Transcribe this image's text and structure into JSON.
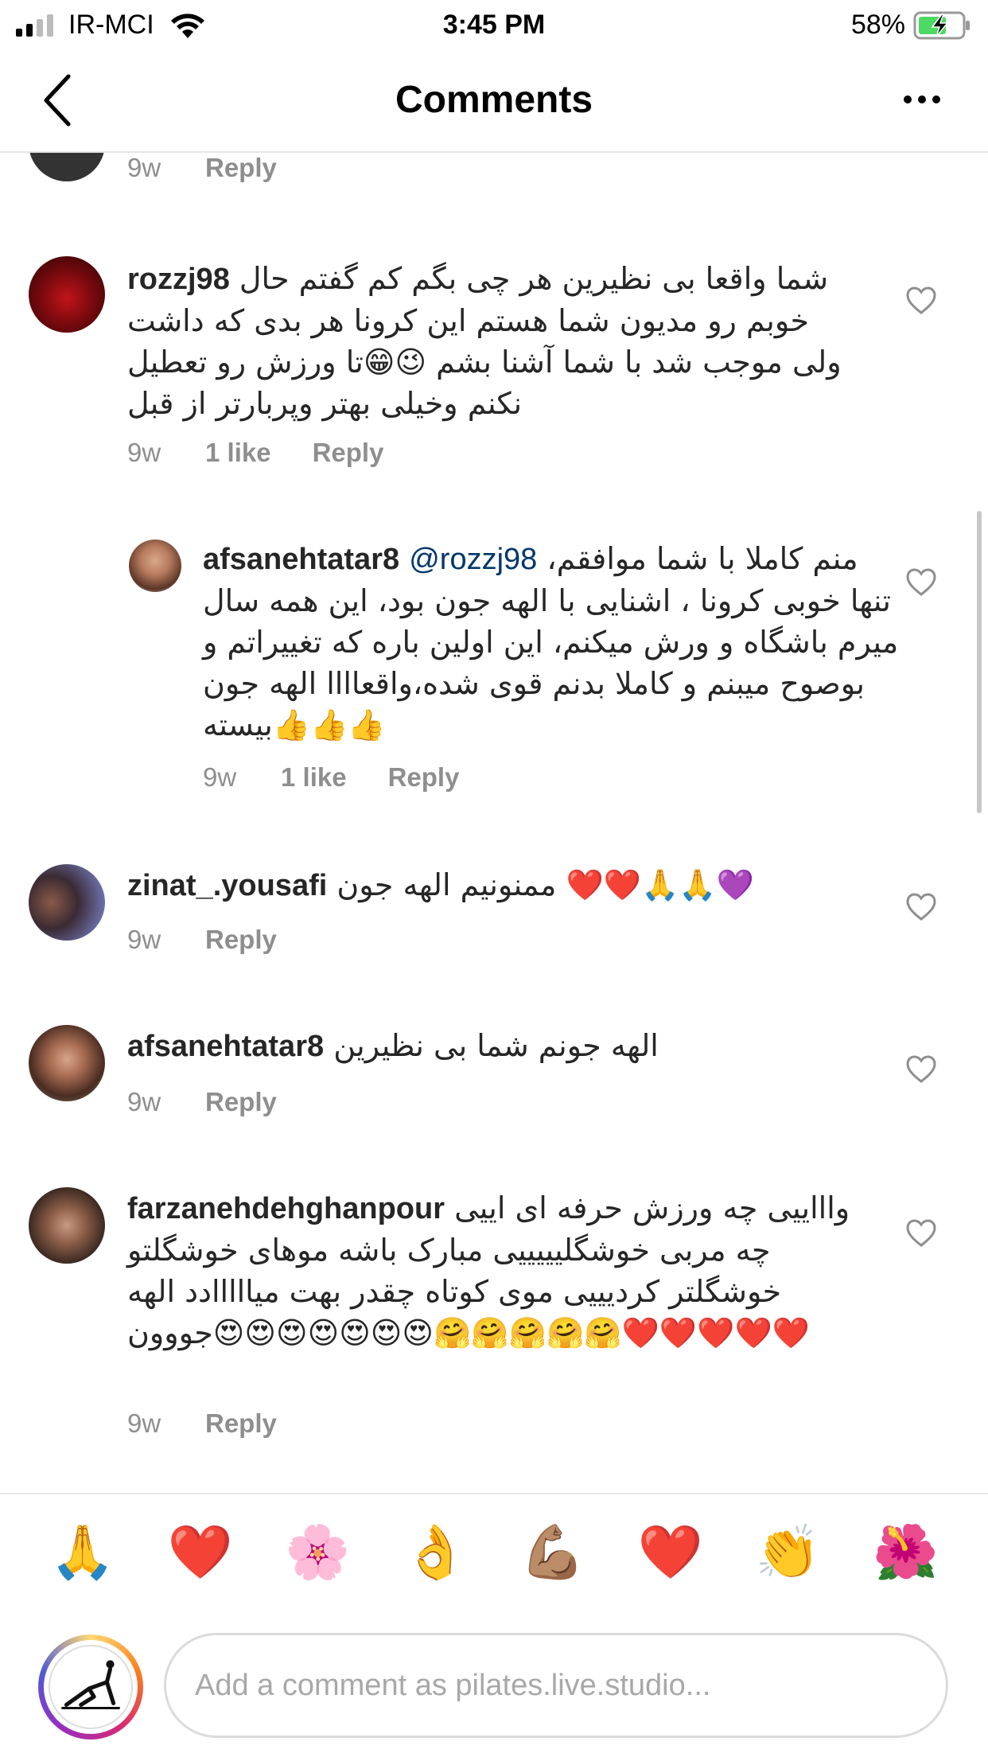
{
  "status_bar": {
    "carrier": "IR-MCI",
    "time": "3:45 PM",
    "battery_percent": "58%"
  },
  "header": {
    "title": "Comments"
  },
  "comments": [
    {
      "age": "9w",
      "reply_label": "Reply"
    },
    {
      "username": "rozzj98",
      "text": "شما واقعا بی نظیرین هر چی بگم کم گفتم حال خوبم رو مدیون شما هستم این کرونا هر بدی که داشت ولی موجب شد با شما آشنا بشم 😉😁تا ورزش رو تعطیل نکنم وخیلی بهتر وپربارتر از قبل",
      "age": "9w",
      "likes": "1 like",
      "reply_label": "Reply"
    },
    {
      "username": "afsanehtatar8",
      "mention": "@rozzj98",
      "text": "منم کاملا با شما موافقم، تنها خوبی کرونا ، اشنایی با الهه جون بود، این همه سال میرم باشگاه و ورش میکنم، این اولین باره که تغییراتم و بوصوح میبنم و کاملا بدنم قوی شده،واقعاااا الهه جون بیسته👍👍👍",
      "age": "9w",
      "likes": "1 like",
      "reply_label": "Reply"
    },
    {
      "username": "zinat_.yousafi",
      "text": "ممنونیم الهه جون ❤️❤️🙏🙏💜",
      "age": "9w",
      "reply_label": "Reply"
    },
    {
      "username": "afsanehtatar8",
      "text": "الهه جونم شما بی نظیرین",
      "age": "9w",
      "reply_label": "Reply"
    },
    {
      "username": "farzanehdehghanpour",
      "text": "واااییی چه ورزش حرفه ای اییی چه مربی خوشگلیییییی مبارک باشه موهای خوشگلتو خوشگلتر کردیییی موی کوتاه چقدر بهت میااااادد الهه جووون😍😍😍😍😍😍😍🤗🤗🤗🤗🤗❤️❤️❤️❤️❤️",
      "age": "9w",
      "reply_label": "Reply"
    }
  ],
  "quick_emojis": [
    "🙏",
    "❤️",
    "🌸",
    "👌",
    "💪🏽",
    "❤️",
    "👏",
    "🌺"
  ],
  "composer": {
    "placeholder": "Add a comment as pilates.live.studio..."
  },
  "colors": {
    "text": "#262626",
    "meta": "#8e8e8e",
    "mention": "#00376b",
    "divider": "#e6e6e6",
    "battery": "#4cd964"
  }
}
